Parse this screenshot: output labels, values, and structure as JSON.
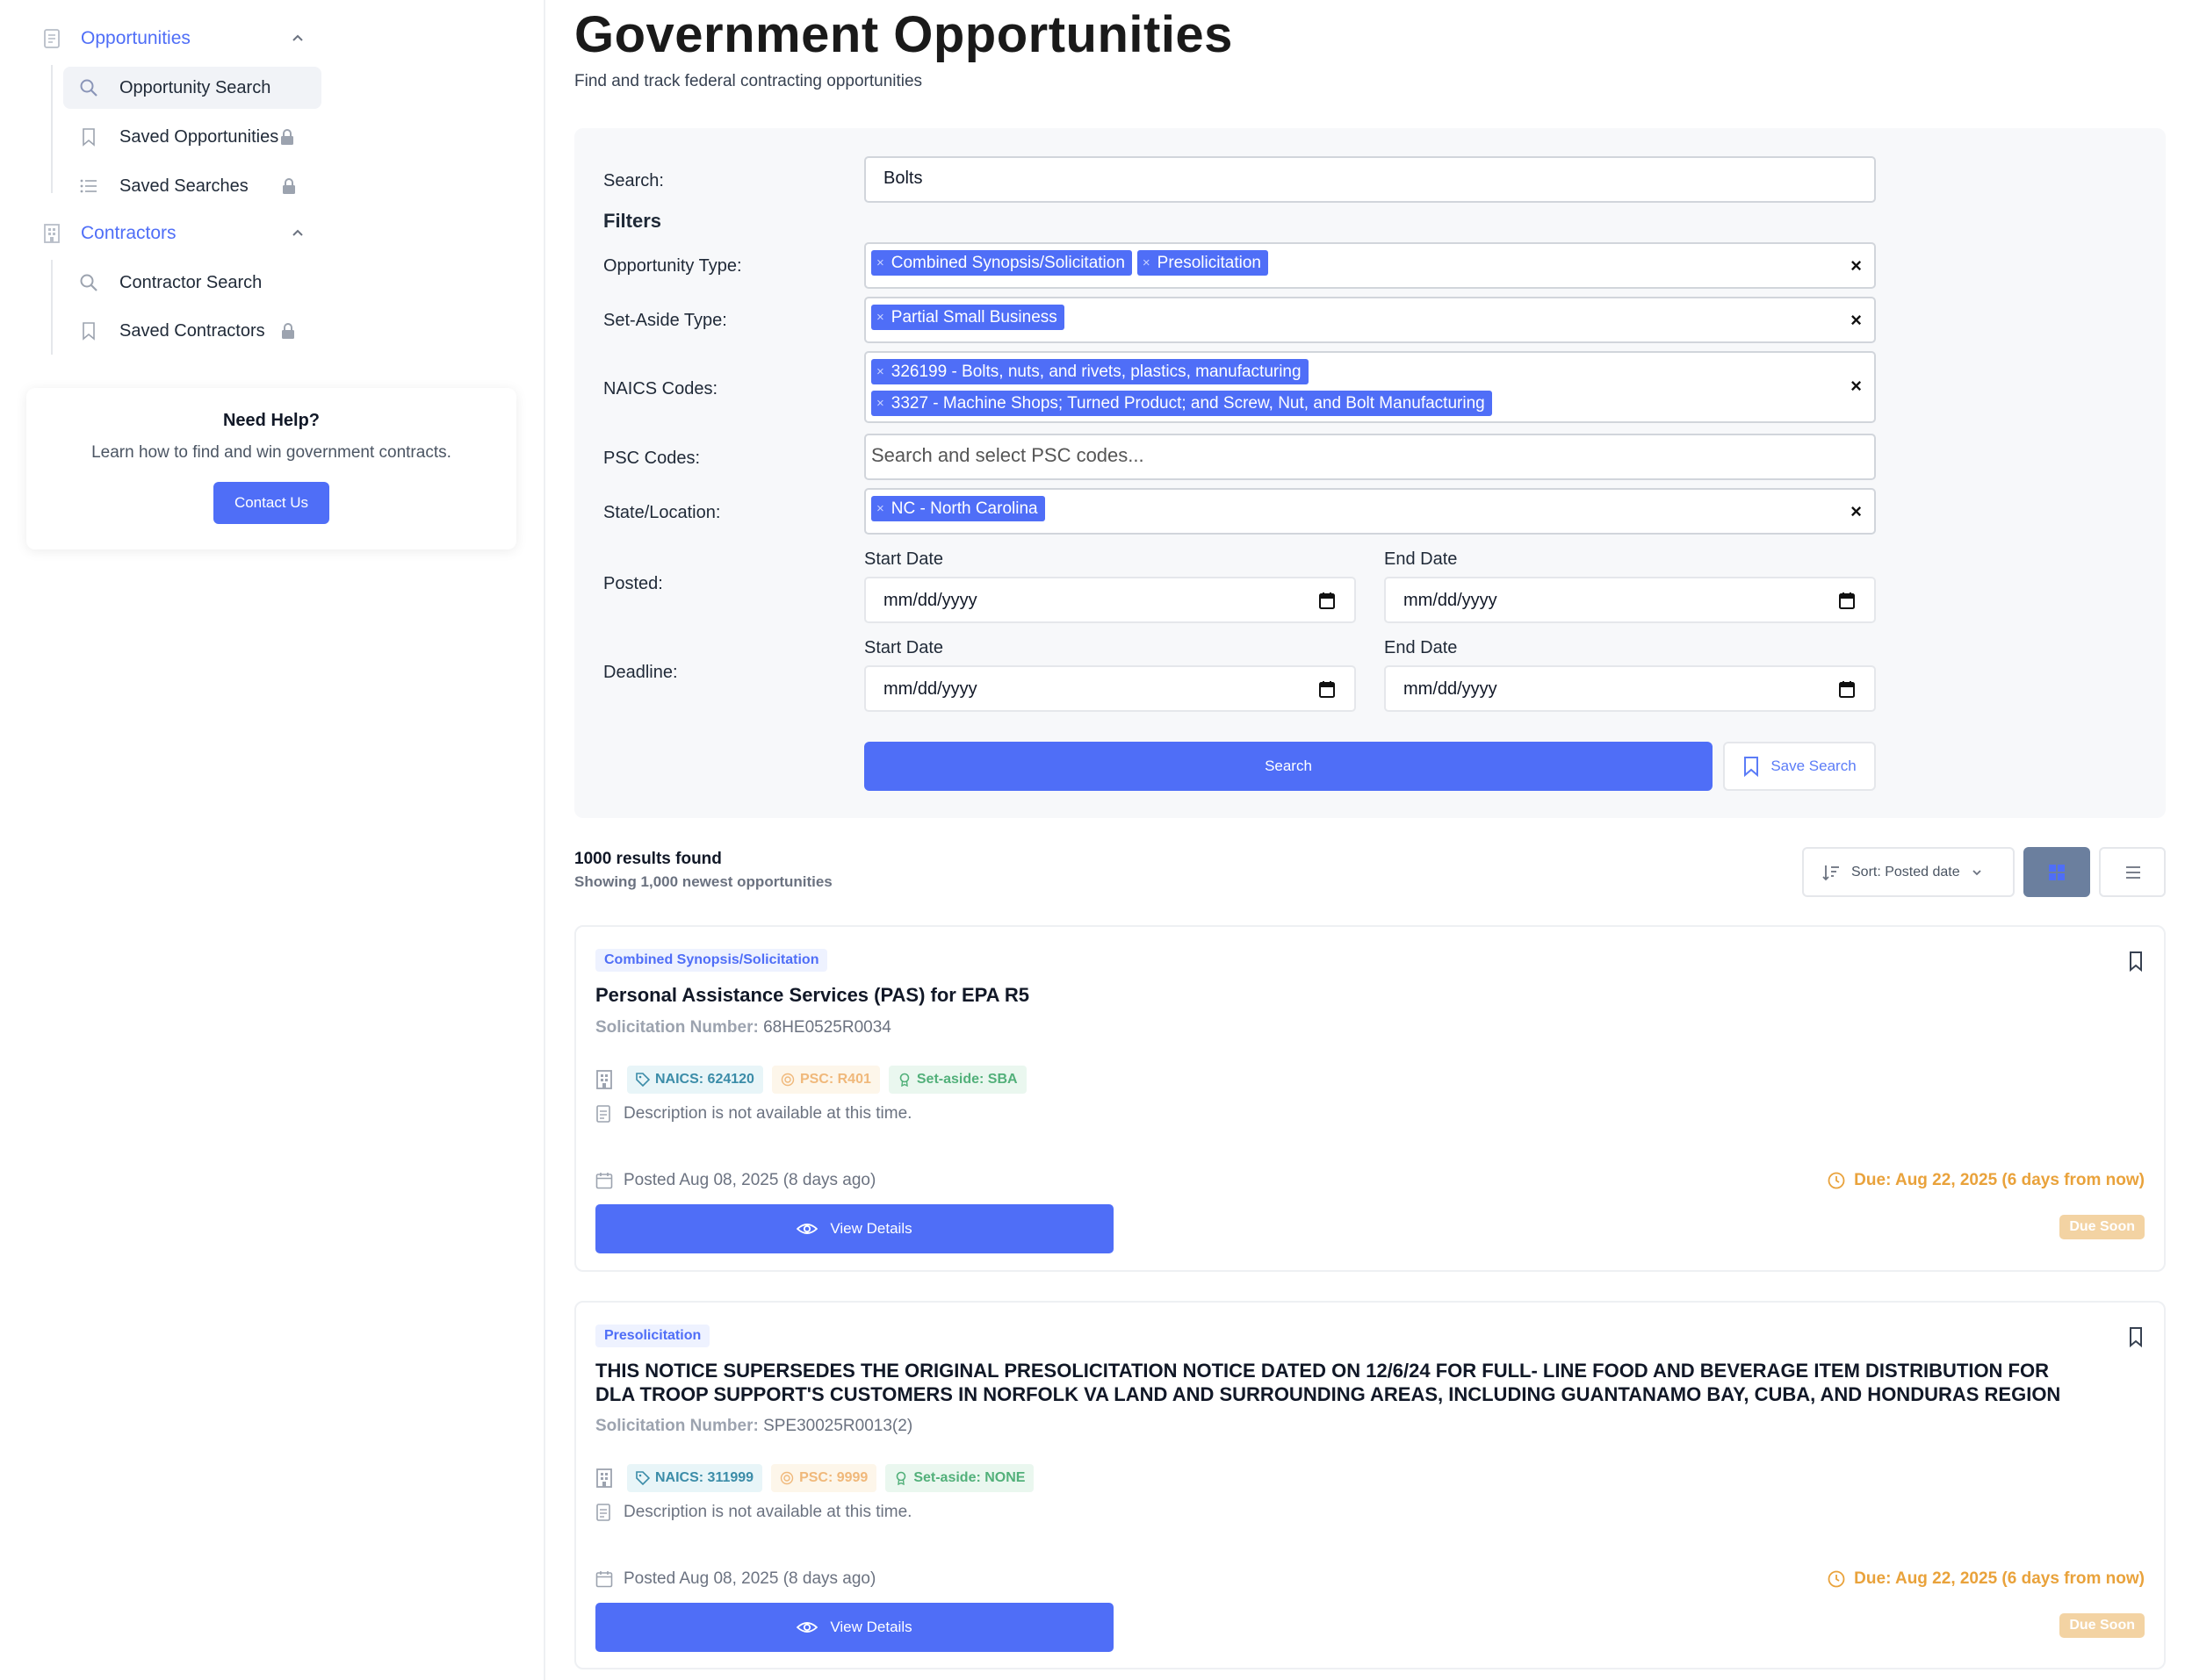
{
  "sidebar": {
    "groups": [
      {
        "label": "Opportunities",
        "icon": "document-icon",
        "items": [
          {
            "label": "Opportunity Search",
            "icon": "search-icon",
            "active": true,
            "locked": false
          },
          {
            "label": "Saved Opportunities",
            "icon": "bookmark-icon",
            "active": false,
            "locked": true
          },
          {
            "label": "Saved Searches",
            "icon": "list-icon",
            "active": false,
            "locked": true
          }
        ]
      },
      {
        "label": "Contractors",
        "icon": "building-icon",
        "items": [
          {
            "label": "Contractor Search",
            "icon": "search-icon",
            "active": false,
            "locked": false
          },
          {
            "label": "Saved Contractors",
            "icon": "bookmark-icon",
            "active": false,
            "locked": true
          }
        ]
      }
    ],
    "help": {
      "title": "Need Help?",
      "text": "Learn how to find and win government contracts.",
      "button": "Contact Us"
    }
  },
  "header": {
    "title": "Government Opportunities",
    "subtitle": "Find and track federal contracting opportunities"
  },
  "form": {
    "search_label": "Search:",
    "search_value": "Bolts",
    "filters_heading": "Filters",
    "opportunity_type": {
      "label": "Opportunity Type:",
      "tags": [
        "Combined Synopsis/Solicitation",
        "Presolicitation"
      ]
    },
    "set_aside": {
      "label": "Set-Aside Type:",
      "tags": [
        "Partial Small Business"
      ]
    },
    "naics": {
      "label": "NAICS Codes:",
      "tags": [
        "326199 - Bolts, nuts, and rivets, plastics, manufacturing",
        "3327 - Machine Shops; Turned Product; and Screw, Nut, and Bolt Manufacturing"
      ]
    },
    "psc": {
      "label": "PSC Codes:",
      "placeholder": "Search and select PSC codes..."
    },
    "state": {
      "label": "State/Location:",
      "tags": [
        "NC - North Carolina"
      ]
    },
    "tag_remove": "×",
    "clear_glyph": "×",
    "posted": {
      "label": "Posted:",
      "start_label": "Start Date",
      "end_label": "End Date",
      "start_value": "mm/dd/yyyy",
      "end_value": "mm/dd/yyyy"
    },
    "deadline": {
      "label": "Deadline:",
      "start_label": "Start Date",
      "end_label": "End Date",
      "start_value": "mm/dd/yyyy",
      "end_value": "mm/dd/yyyy"
    },
    "search_button": "Search",
    "save_search_button": "Save Search"
  },
  "results": {
    "count": "1000 results found",
    "sub": "Showing 1,000 newest opportunities",
    "sort_label": "Sort: Posted date",
    "view_mode": "grid",
    "cards": [
      {
        "type": "Combined Synopsis/Solicitation",
        "title": "Personal Assistance Services (PAS) for EPA R5",
        "sol_label": "Solicitation Number:",
        "sol_number": "68HE0525R0034",
        "naics": "NAICS: 624120",
        "psc": "PSC: R401",
        "setaside": "Set-aside: SBA",
        "description": "Description is not available at this time.",
        "posted": "Posted Aug 08, 2025 (8 days ago)",
        "due": "Due: Aug 22, 2025 (6 days from now)",
        "view_button": "View Details",
        "status": "Due Soon"
      },
      {
        "type": "Presolicitation",
        "title": "THIS NOTICE SUPERSEDES THE ORIGINAL PRESOLICITATION NOTICE DATED ON 12/6/24 FOR FULL- LINE FOOD AND BEVERAGE ITEM DISTRIBUTION FOR DLA TROOP SUPPORT'S CUSTOMERS IN NORFOLK VA LAND AND SURROUNDING AREAS, INCLUDING GUANTANAMO BAY, CUBA, AND HONDURAS REGION",
        "sol_label": "Solicitation Number:",
        "sol_number": "SPE30025R0013(2)",
        "naics": "NAICS: 311999",
        "psc": "PSC: 9999",
        "setaside": "Set-aside: NONE",
        "description": "Description is not available at this time.",
        "posted": "Posted Aug 08, 2025 (8 days ago)",
        "due": "Due: Aug 22, 2025 (6 days from now)",
        "view_button": "View Details",
        "status": "Due Soon"
      }
    ]
  },
  "colors": {
    "accent": "#4f6ef7",
    "due": "#e9a23b",
    "due_soon_badge": "#f3d3a3"
  }
}
